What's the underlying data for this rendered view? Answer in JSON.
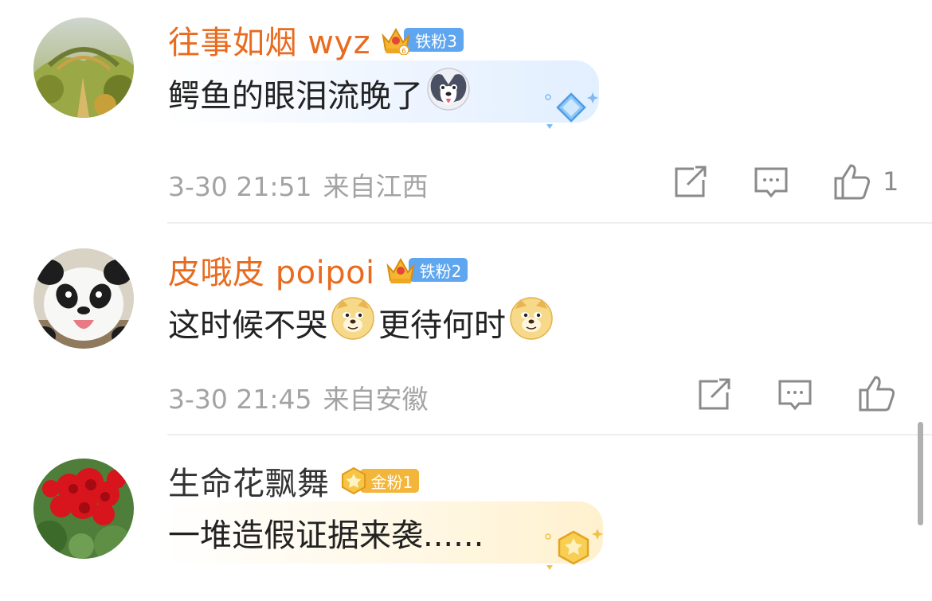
{
  "comments": [
    {
      "username": "往事如烟 wyz",
      "badge": {
        "label": "铁粉3",
        "crown_level": "6"
      },
      "text": "鳄鱼的眼泪流晚了",
      "emoji": "husky-emoji",
      "time": "3-30 21:51",
      "location": "来自江西",
      "likes": "1"
    },
    {
      "username": "皮哦皮 poipoi",
      "badge": {
        "label": "铁粉2"
      },
      "text_part1": "这时候不哭",
      "text_part2": "更待何时",
      "emoji": "doge-emoji",
      "time": "3-30 21:45",
      "location": "来自安徽",
      "likes": ""
    },
    {
      "username": "生命花飘舞",
      "badge": {
        "label": "金粉1"
      },
      "text": "一堆造假证据来袭......"
    }
  ],
  "colors": {
    "username_vip": "#e86b1f",
    "meta_gray": "#a3a3a3",
    "iron_fan_badge": "#5fa6f0",
    "gold_fan_badge": "#f3b63a"
  }
}
